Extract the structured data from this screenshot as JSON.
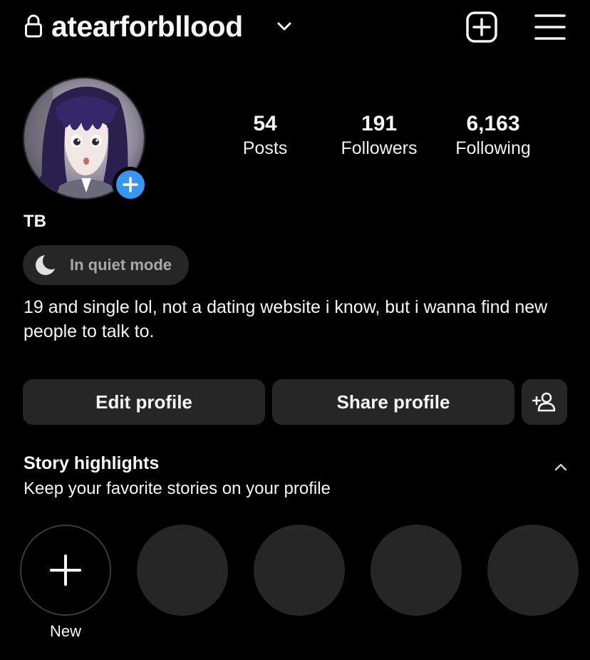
{
  "header": {
    "username": "atearforbllood",
    "lock_icon": "lock-icon",
    "chevron_icon": "chevron-down-icon",
    "create_icon": "plus-square-icon",
    "menu_icon": "hamburger-menu-icon"
  },
  "profile": {
    "avatar_icon": "avatar-image",
    "add_story_icon": "plus-icon",
    "display_name": "TB",
    "quiet_mode_label": "In quiet mode",
    "quiet_mode_icon": "moon-icon",
    "bio": "19 and single lol, not a dating website i know, but i wanna find new people to talk to."
  },
  "stats": [
    {
      "value": "54",
      "label": "Posts"
    },
    {
      "value": "191",
      "label": "Followers"
    },
    {
      "value": "6,163",
      "label": "Following"
    }
  ],
  "actions": {
    "edit_label": "Edit profile",
    "share_label": "Share profile",
    "discover_icon": "add-person-icon"
  },
  "highlights": {
    "title": "Story highlights",
    "subtitle": "Keep your favorite stories on your profile",
    "new_label": "New",
    "collapse_icon": "chevron-up-icon"
  },
  "colors": {
    "background": "#000000",
    "surface": "#262626",
    "accent_blue": "#3797f0",
    "muted_text": "#a8a8a8"
  }
}
